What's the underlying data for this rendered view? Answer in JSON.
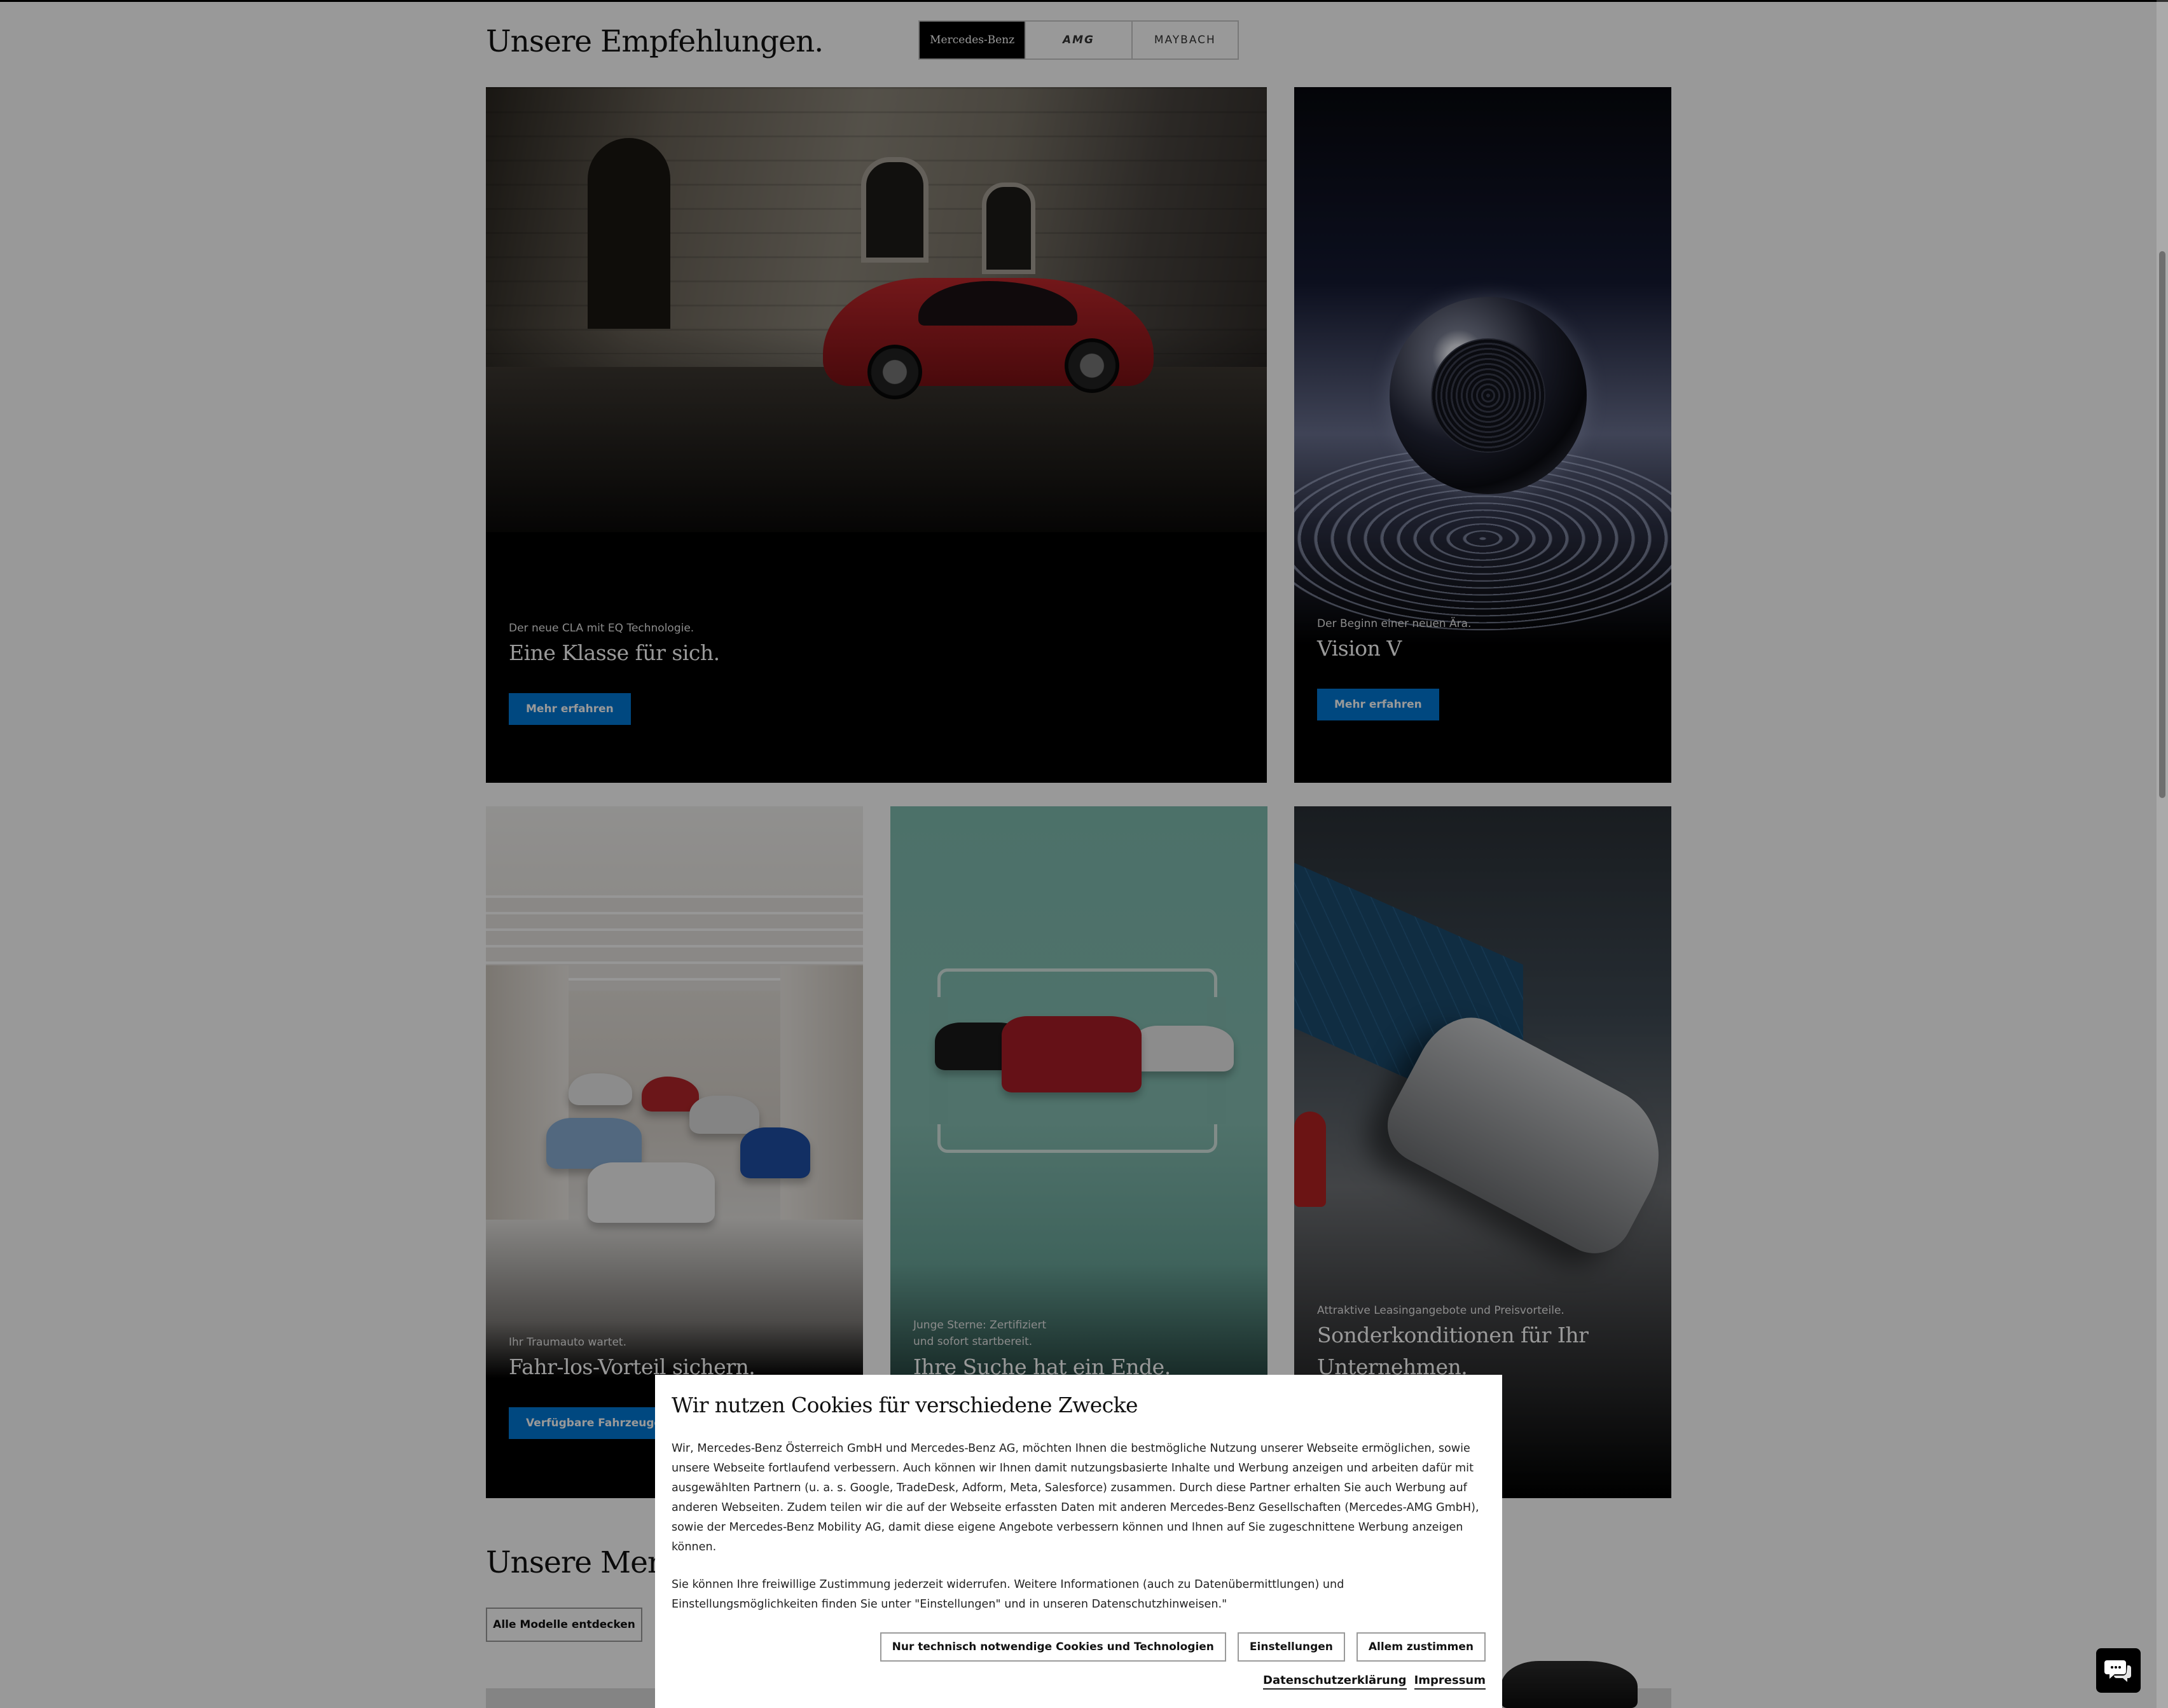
{
  "section": {
    "title": "Unsere Empfehlungen.",
    "brand_tabs": [
      "Mercedes-Benz",
      "AMG",
      "MAYBACH"
    ]
  },
  "tiles": [
    {
      "kicker": "Der neue CLA mit EQ Technologie.",
      "headline": "Eine Klasse für sich.",
      "cta": "Mehr erfahren"
    },
    {
      "kicker": "Der Beginn einer neuen Ära.",
      "headline": "Vision V",
      "cta": "Mehr erfahren"
    },
    {
      "kicker": "Ihr Traumauto wartet.",
      "headline": "Fahr-los-Vorteil sichern.",
      "cta": "Verfügbare Fahrzeuge ansehen"
    },
    {
      "kicker1": "Junge Sterne: Zertifiziert",
      "kicker2": "und sofort startbereit.",
      "headline": "Ihre Suche hat ein Ende."
    },
    {
      "kicker": "Attraktive Leasingangebote und Preisvorteile.",
      "headline1": "Sonderkonditionen für Ihr",
      "headline2": "Unternehmen."
    }
  ],
  "section2": {
    "title": "Unsere Mercedes-Benz Modelle.",
    "button": "Alle Modelle entdecken"
  },
  "cookie": {
    "title": "Wir nutzen Cookies für verschiedene Zwecke",
    "paragraph1": "Wir, Mercedes-Benz Österreich GmbH und Mercedes-Benz AG, möchten Ihnen die bestmögliche Nutzung unserer Webseite ermöglichen, sowie unsere Webseite fortlaufend verbessern. Auch können wir Ihnen damit nutzungsbasierte Inhalte und Werbung anzeigen und arbeiten dafür mit ausgewählten Partnern (u. a. s. Google, TradeDesk, Adform, Meta, Salesforce) zusammen. Durch diese Partner erhalten Sie auch Werbung auf anderen Webseiten. Zudem teilen wir die auf der Webseite erfassten Daten mit anderen Mercedes-Benz Gesellschaften (Mercedes-AMG GmbH), sowie der Mercedes-Benz Mobility AG, damit diese eigene Angebote verbessern können und Ihnen auf Sie zugeschnittene Werbung anzeigen können.",
    "paragraph2": "Sie können Ihre freiwillige Zustimmung jederzeit widerrufen. Weitere Informationen (auch zu Datenübermittlungen) und Einstellungsmöglichkeiten finden Sie unter \"Einstellungen\" und in unseren Datenschutzhinweisen.\"",
    "buttons": {
      "necessary": "Nur technisch notwendige Cookies und Technologien",
      "settings": "Einstellungen",
      "accept_all": "Allem zustimmen"
    },
    "links": {
      "privacy": "Datenschutzerklärung",
      "imprint": "Impressum"
    }
  },
  "icons": {
    "chat": "chat-bubble-icon"
  }
}
